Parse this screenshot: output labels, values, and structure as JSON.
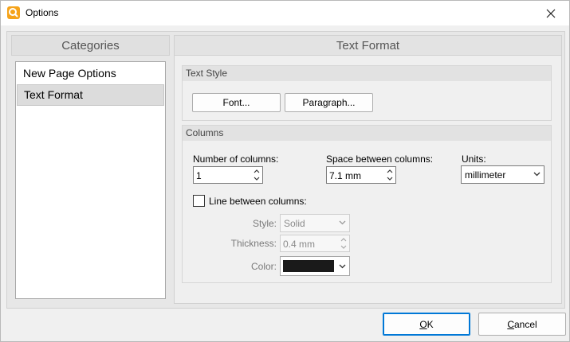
{
  "window": {
    "title": "Options"
  },
  "categories": {
    "header": "Categories",
    "items": [
      {
        "label": "New Page Options",
        "selected": false
      },
      {
        "label": "Text Format",
        "selected": true
      }
    ]
  },
  "panel": {
    "header": "Text Format",
    "text_style": {
      "title": "Text Style",
      "font_button": "Font...",
      "paragraph_button": "Paragraph..."
    },
    "columns": {
      "title": "Columns",
      "number_label": "Number of columns:",
      "number_value": "1",
      "space_label": "Space between columns:",
      "space_value": "7.1 mm",
      "units_label": "Units:",
      "units_value": "millimeter",
      "line_label": "Line between columns:",
      "line_checked": false,
      "style_label": "Style:",
      "style_value": "Solid",
      "thickness_label": "Thickness:",
      "thickness_value": "0.4 mm",
      "color_label": "Color:",
      "color_value": "#1a1a1a"
    }
  },
  "footer": {
    "ok_first": "O",
    "ok_rest": "K",
    "cancel_first": "C",
    "cancel_rest": "ancel"
  }
}
